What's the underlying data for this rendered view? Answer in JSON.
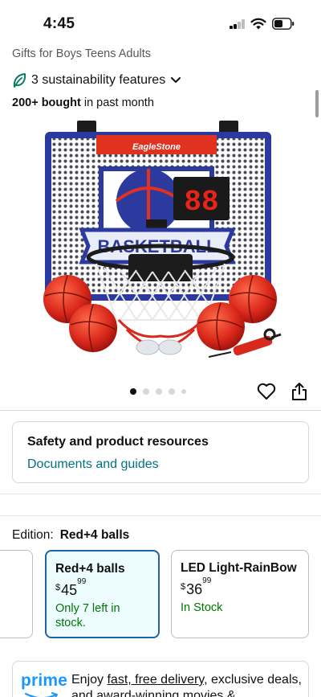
{
  "status_bar": {
    "time": "4:45"
  },
  "product": {
    "subtitle": "Gifts for Boys Teens Adults",
    "sustainability": "3 sustainability features",
    "bought_bold": "200+ bought",
    "bought_rest": " in past month",
    "image": {
      "brand_text": "EagleStone",
      "board_text": "BASKETBALL",
      "score_text": "88"
    },
    "carousel": {
      "total": 5,
      "active_index": 0
    }
  },
  "safety": {
    "title": "Safety and product resources",
    "link": "Documents and guides"
  },
  "edition": {
    "label": "Edition:",
    "selected": "Red+4 balls",
    "options": [
      {
        "title": "",
        "price_whole": "",
        "price_frac": "",
        "stock": ""
      },
      {
        "title": "Red+4 balls",
        "currency": "$",
        "price_whole": "45",
        "price_frac": "99",
        "stock": "Only 7 left in stock."
      },
      {
        "title": "LED Light-RainBow",
        "currency": "$",
        "price_whole": "36",
        "price_frac": "99",
        "stock": "In Stock"
      }
    ]
  },
  "prime": {
    "logo": "prime",
    "text_1": "Enjoy ",
    "text_link": "fast, free delivery,",
    "text_2": " exclusive deals, and award-winning movies &"
  },
  "colors": {
    "link": "#007185",
    "stock_green": "#007600",
    "selected_border": "#2162a1",
    "prime_blue": "#1a98ff"
  },
  "icons": {
    "sustainability": "leaf-icon",
    "wishlist": "heart-icon",
    "share": "share-icon"
  }
}
